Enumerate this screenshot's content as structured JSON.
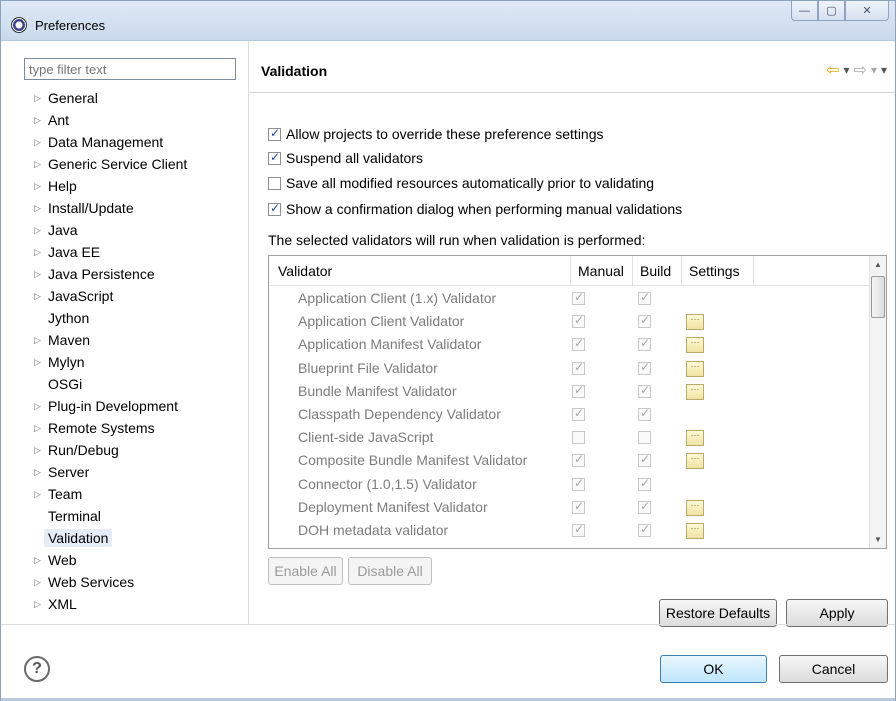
{
  "window": {
    "title": "Preferences",
    "app_icon": "eclipse-icon",
    "minimize_glyph": "—",
    "maximize_glyph": "▢",
    "close_glyph": "✕"
  },
  "sidebar": {
    "filter_placeholder": "type filter text",
    "items": [
      {
        "label": "General",
        "expandable": true
      },
      {
        "label": "Ant",
        "expandable": true
      },
      {
        "label": "Data Management",
        "expandable": true
      },
      {
        "label": "Generic Service Client",
        "expandable": true
      },
      {
        "label": "Help",
        "expandable": true
      },
      {
        "label": "Install/Update",
        "expandable": true
      },
      {
        "label": "Java",
        "expandable": true
      },
      {
        "label": "Java EE",
        "expandable": true
      },
      {
        "label": "Java Persistence",
        "expandable": true
      },
      {
        "label": "JavaScript",
        "expandable": true
      },
      {
        "label": "Jython",
        "expandable": false
      },
      {
        "label": "Maven",
        "expandable": true
      },
      {
        "label": "Mylyn",
        "expandable": true
      },
      {
        "label": "OSGi",
        "expandable": false
      },
      {
        "label": "Plug-in Development",
        "expandable": true
      },
      {
        "label": "Remote Systems",
        "expandable": true
      },
      {
        "label": "Run/Debug",
        "expandable": true
      },
      {
        "label": "Server",
        "expandable": true
      },
      {
        "label": "Team",
        "expandable": true
      },
      {
        "label": "Terminal",
        "expandable": false
      },
      {
        "label": "Validation",
        "expandable": false,
        "selected": true
      },
      {
        "label": "Web",
        "expandable": true
      },
      {
        "label": "Web Services",
        "expandable": true
      },
      {
        "label": "XML",
        "expandable": true
      }
    ]
  },
  "page": {
    "title": "Validation",
    "options": [
      {
        "label": "Allow projects to override these preference settings",
        "checked": true
      },
      {
        "label": "Suspend all validators",
        "checked": true
      },
      {
        "label": "Save all modified resources automatically prior to validating",
        "checked": false
      },
      {
        "label": "Show a confirmation dialog when performing manual validations",
        "checked": true
      }
    ],
    "description": "The selected validators will run when validation is performed:",
    "table": {
      "columns": [
        "Validator",
        "Manual",
        "Build",
        "Settings"
      ],
      "rows": [
        {
          "name": "Application Client (1.x) Validator",
          "manual": true,
          "build": true,
          "settings": false
        },
        {
          "name": "Application Client Validator",
          "manual": true,
          "build": true,
          "settings": true
        },
        {
          "name": "Application Manifest Validator",
          "manual": true,
          "build": true,
          "settings": true
        },
        {
          "name": "Blueprint File Validator",
          "manual": true,
          "build": true,
          "settings": true
        },
        {
          "name": "Bundle Manifest Validator",
          "manual": true,
          "build": true,
          "settings": true
        },
        {
          "name": "Classpath Dependency Validator",
          "manual": true,
          "build": true,
          "settings": false
        },
        {
          "name": "Client-side JavaScript",
          "manual": false,
          "build": false,
          "settings": true
        },
        {
          "name": "Composite Bundle Manifest Validator",
          "manual": true,
          "build": true,
          "settings": true
        },
        {
          "name": "Connector (1.0,1.5) Validator",
          "manual": true,
          "build": true,
          "settings": false
        },
        {
          "name": "Deployment Manifest Validator",
          "manual": true,
          "build": true,
          "settings": true
        },
        {
          "name": "DOH metadata validator",
          "manual": true,
          "build": true,
          "settings": true
        }
      ],
      "settings_glyph": "···"
    },
    "enable_all": "Enable All",
    "disable_all": "Disable All",
    "restore_defaults": "Restore Defaults",
    "apply": "Apply"
  },
  "footer": {
    "help_glyph": "?",
    "ok": "OK",
    "cancel": "Cancel"
  }
}
